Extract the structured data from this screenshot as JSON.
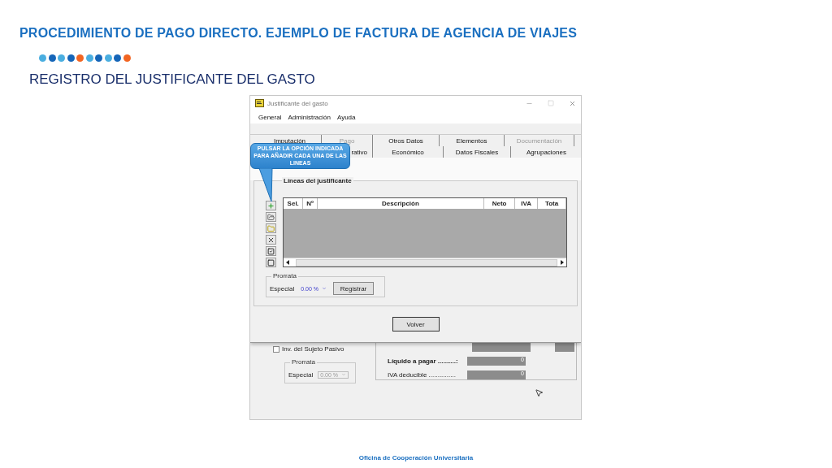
{
  "slide": {
    "title": "PROCEDIMIENTO DE PAGO DIRECTO. EJEMPLO DE FACTURA DE AGENCIA DE VIAJES",
    "dots": [
      {
        "color": "#4aaee0"
      },
      {
        "color": "#1565b8"
      },
      {
        "color": "#4aaee0"
      },
      {
        "color": "#1565b8"
      },
      {
        "color": "#f26522"
      },
      {
        "color": "#4aaee0"
      },
      {
        "color": "#1565b8"
      },
      {
        "color": "#4aaee0"
      },
      {
        "color": "#1565b8"
      },
      {
        "color": "#f26522"
      }
    ],
    "subtitle": "REGISTRO DEL JUSTIFICANTE DEL GASTO",
    "footer": "Oficina de Cooperación Universitaria"
  },
  "window": {
    "title": "Justificante del gasto",
    "menu": [
      "General",
      "Administración",
      "Ayuda"
    ],
    "tab_rows": [
      [
        {
          "label": "Imputación",
          "disabled": false
        },
        {
          "label": "Pago",
          "disabled": true
        },
        {
          "label": "Otros Datos",
          "disabled": false
        },
        {
          "label": "Elementos",
          "disabled": false
        },
        {
          "label": "Documentación",
          "disabled": true
        }
      ],
      [
        {
          "label": "rativo"
        },
        {
          "label": "Económico"
        },
        {
          "label": "Datos Fiscales"
        },
        {
          "label": "Agrupaciones"
        }
      ]
    ],
    "callout": "PULSAR LA OPCIÓN INDICADA PARA AÑADIR CADA UNA DE LAS LINEAS",
    "lines_group": {
      "title": "Líneas del justificante",
      "columns": [
        "Sel.",
        "Nº",
        "Descripción",
        "Neto",
        "IVA",
        "Tota"
      ],
      "prorrata": {
        "legend": "Prorrata",
        "label": "Especial",
        "value": "0.00 %",
        "button": "Registrar"
      }
    },
    "close_button": "Volver"
  },
  "background_window": {
    "checkbox": {
      "label": "Inv. del Sujeto Pasivo",
      "checked": false
    },
    "prorrata": {
      "legend": "Prorrata",
      "label": "Especial",
      "value": "0.00 %",
      "disabled": true
    },
    "totals": [
      {
        "label": "Líquido a pagar ..........:",
        "value": "0",
        "bold": true
      },
      {
        "label": "IVA deducible ...............",
        "value": "0",
        "bold": false
      }
    ]
  }
}
